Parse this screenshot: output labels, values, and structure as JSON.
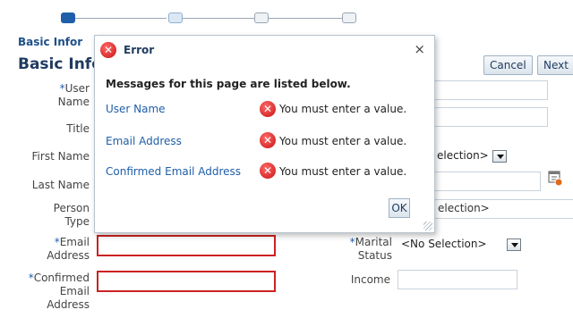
{
  "train": {
    "current_label": "Basic Infor"
  },
  "page": {
    "title": "Basic Info"
  },
  "buttons": {
    "cancel": "Cancel",
    "next": "Next"
  },
  "form": {
    "required_mark": "*",
    "user_name_label_a": "User",
    "user_name_label_b": "Name",
    "title_label": "Title",
    "first_name_label": "First Name",
    "last_name_label": "Last Name",
    "person_type_label_a": "Person",
    "person_type_label_b": "Type",
    "email_label_a": "Email",
    "email_label_b": "Address",
    "confirmed_email_label_a": "Confirmed",
    "confirmed_email_label_b": "Email",
    "confirmed_email_label_c": "Address",
    "marital_label_a": "Marital",
    "marital_label_b": "Status",
    "marital_value": "<No Selection>",
    "income_label": "Income",
    "partial_select_1": "election>",
    "partial_select_2": "election>"
  },
  "dialog": {
    "title": "Error",
    "close": "×",
    "heading": "Messages for this page are listed below.",
    "messages": [
      {
        "field": "User Name",
        "text": "You must enter a value."
      },
      {
        "field": "Email Address",
        "text": "You must enter a value."
      },
      {
        "field": "Confirmed Email Address",
        "text": "You must enter a value."
      }
    ],
    "ok": "OK"
  },
  "icons": {
    "error": "error-x-icon",
    "calendar": "calendar-icon",
    "dropdown": "dropdown-arrow-icon"
  },
  "colors": {
    "accent": "#1f5ea8",
    "error": "#cc2222"
  }
}
